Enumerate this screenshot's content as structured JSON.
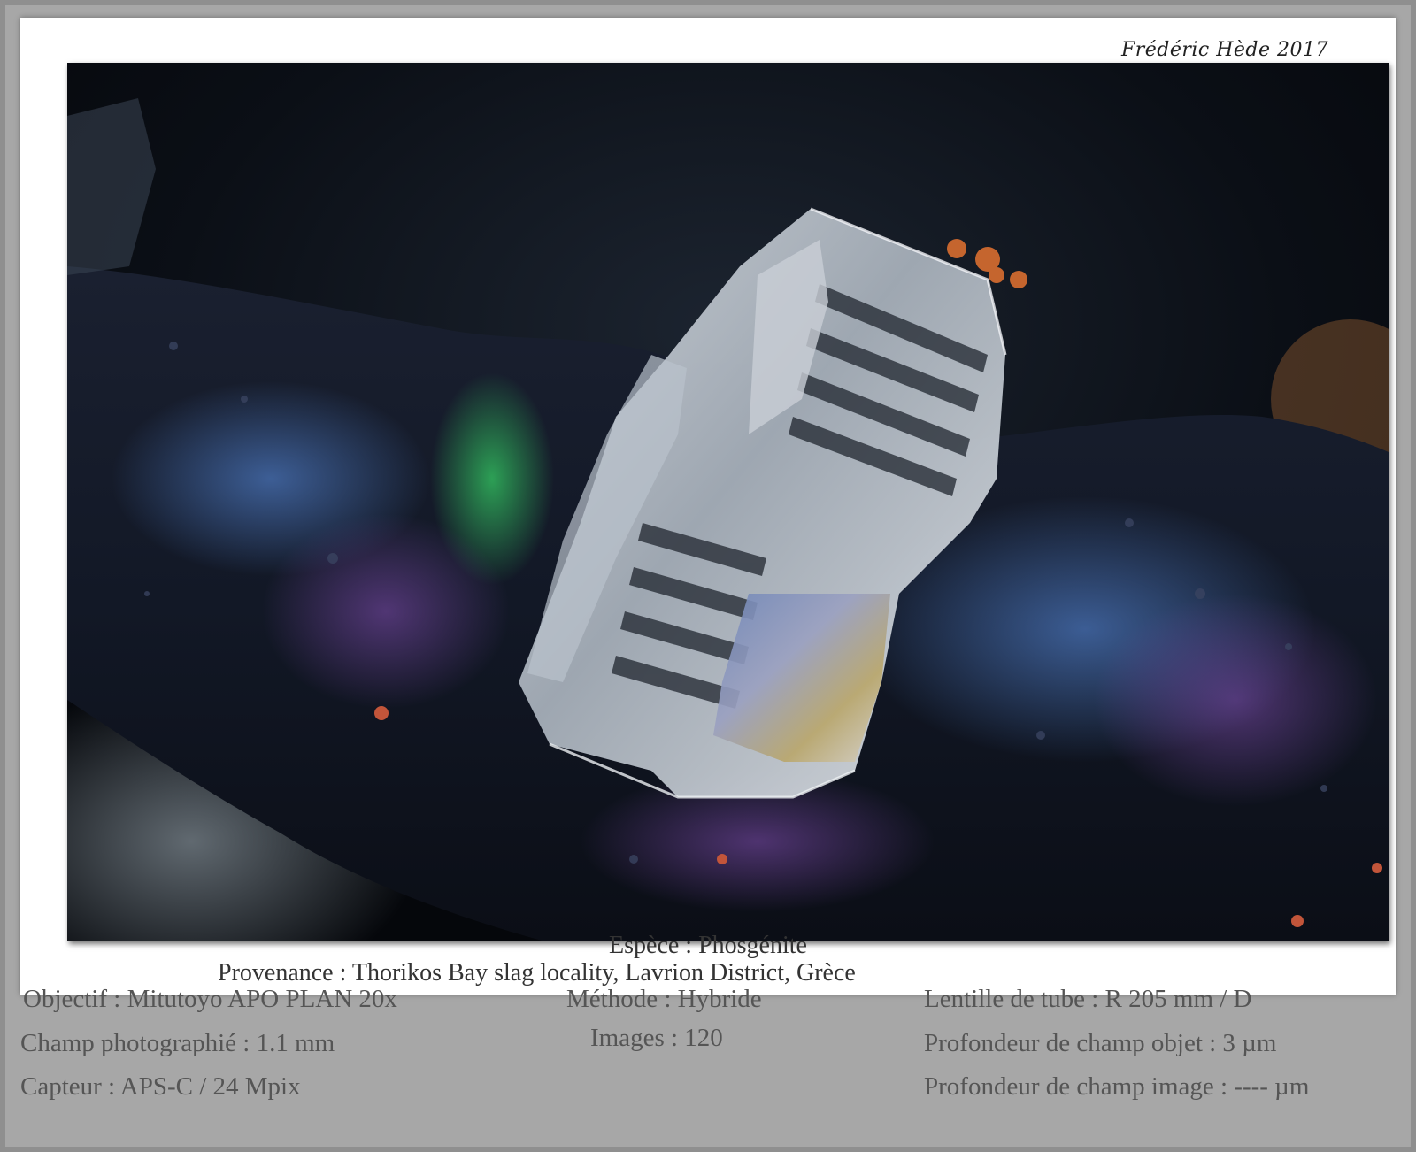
{
  "signature": "Frédéric Hède 2017",
  "caption": {
    "species": "Espèce : Phosgénite",
    "provenance": "Provenance : Thorikos Bay slag locality, Lavrion District, Grèce"
  },
  "info": {
    "col1": [
      "Objectif : Mitutoyo APO PLAN 20x",
      "Champ photographié : 1.1 mm",
      "Capteur : APS-C / 24 Mpix"
    ],
    "col2": [
      "Méthode : Hybride",
      "Images : 120"
    ],
    "col3": [
      "Lentille de tube : R 205 mm / D",
      "Profondeur de champ objet : 3 µm",
      "Profondeur de champ image : ---- µm"
    ]
  },
  "colors": {
    "frame": "#a7a7a7",
    "card": "#ffffff",
    "text_caption": "#333333",
    "text_info": "#555555",
    "photo_background": "#0c1018"
  }
}
